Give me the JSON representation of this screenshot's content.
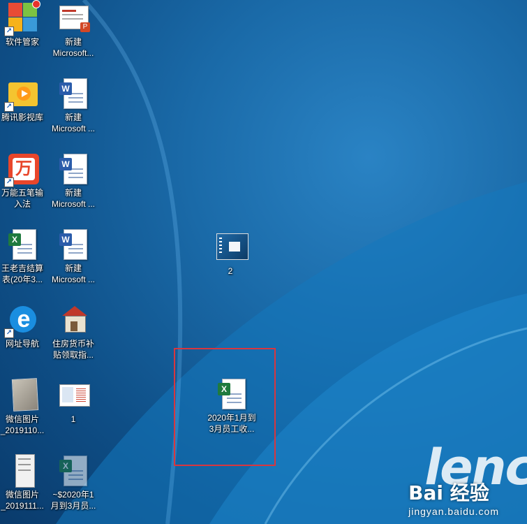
{
  "desktop": {
    "icons": [
      {
        "label": "软件管家",
        "icon": "software-manager-icon"
      },
      {
        "label": "新建\nMicrosoft...",
        "icon": "ppt-doc-icon"
      },
      {
        "label": "腾讯影视库",
        "icon": "folder-video-icon"
      },
      {
        "label": "新建\nMicrosoft ...",
        "icon": "word-doc-icon"
      },
      {
        "label": "万能五笔输\n入法",
        "icon": "wubi-input-icon"
      },
      {
        "label": "新建\nMicrosoft ...",
        "icon": "word-doc-icon"
      },
      {
        "label": "王老吉结算\n表(20年3...",
        "icon": "excel-doc-icon"
      },
      {
        "label": "新建\nMicrosoft ...",
        "icon": "word-doc-icon"
      },
      {
        "label": "网址导航",
        "icon": "ie-browser-icon"
      },
      {
        "label": "住房货币补\n贴领取指...",
        "icon": "house-subsidy-icon"
      },
      {
        "label": "微信图片\n_2019110...",
        "icon": "image-file-icon"
      },
      {
        "label": "1",
        "icon": "screenshot-file-icon"
      },
      {
        "label": "微信图片\n_2019111...",
        "icon": "image-file-icon"
      },
      {
        "label": "~$2020年1\n月到3月员...",
        "icon": "excel-temp-icon"
      },
      {
        "label": "2",
        "icon": "screenshot-file-icon"
      },
      {
        "label": "2020年1月到\n3月员工收...",
        "icon": "excel-doc-icon"
      }
    ]
  },
  "branding": {
    "wallpaper_logo": "lenc",
    "watermark_top": "Bai 经验",
    "watermark_bottom": "jingyan.baidu.com"
  },
  "colors": {
    "selection": "#d9363e",
    "wallpaper": "#1a6aa8"
  }
}
